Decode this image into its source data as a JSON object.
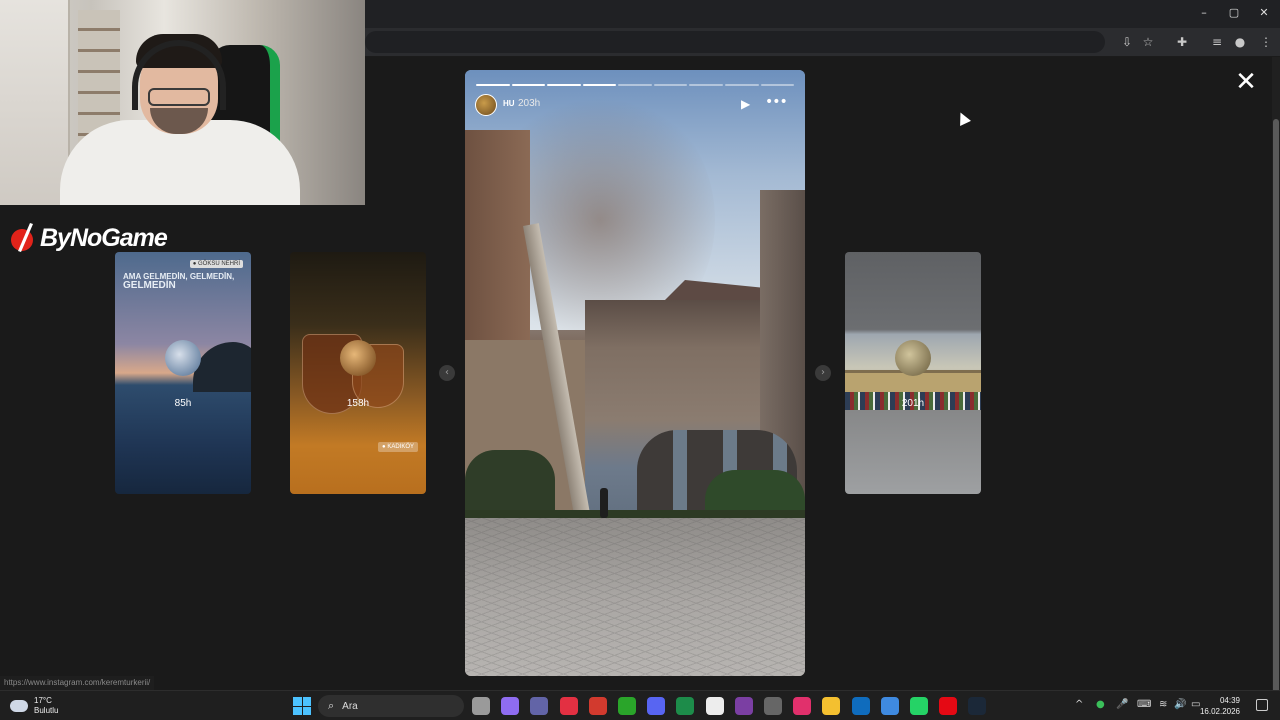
{
  "browser": {
    "window_controls": {
      "minimize": "–",
      "maximize": "▢",
      "close": "✕"
    },
    "toolbar_icons": [
      "install-icon",
      "bookmark-star-icon",
      "extensions-icon",
      "reading-list-icon",
      "profile-icon",
      "menu-icon"
    ]
  },
  "overlay": {
    "brand": "ByNoGame"
  },
  "viewer": {
    "close_label": "✕",
    "prev_arrow": "‹",
    "next_arrow": "›"
  },
  "stories_side": [
    {
      "headline_small": "AMA GELMEDİN, GELMEDİN,",
      "headline_big": "GELMEDİN",
      "tag": "● GÖKSU NEHRİ",
      "time": "85h"
    },
    {
      "tag": "● KADIKÖY",
      "time": "158h"
    },
    {
      "time": "201h"
    }
  ],
  "story_main": {
    "username": "HU",
    "time": "203h",
    "progress_segments": 9,
    "progress_done": 4,
    "play_icon": "▶",
    "more_icon": "•••"
  },
  "status_bar": {
    "url": "https://www.instagram.com/keremturkerii/"
  },
  "taskbar": {
    "weather_temp": "17°C",
    "weather_desc": "Bulutlu",
    "search_placeholder": "Ara",
    "time": "04:39",
    "date": "16.02.2026",
    "apps": [
      {
        "name": "file-view-app-icon",
        "color": "#9a9a9a"
      },
      {
        "name": "copilot-app-icon",
        "color": "#8f6cf0"
      },
      {
        "name": "teams-app-icon",
        "color": "#6264a7"
      },
      {
        "name": "opera-gx-app-icon",
        "color": "#e33042"
      },
      {
        "name": "sw-app-icon",
        "color": "#d23a2e"
      },
      {
        "name": "xbox-app-icon",
        "color": "#2aa52a"
      },
      {
        "name": "discord-app-icon",
        "color": "#5865f2"
      },
      {
        "name": "excel-app-icon",
        "color": "#1d8c4a"
      },
      {
        "name": "messenger-app-icon",
        "color": "#ededed"
      },
      {
        "name": "premiere-app-icon",
        "color": "#7b3fa3"
      },
      {
        "name": "recorder-app-icon",
        "color": "#666666"
      },
      {
        "name": "instagram-app-icon",
        "color": "#e1306c"
      },
      {
        "name": "explorer-app-icon",
        "color": "#f4c030"
      },
      {
        "name": "outlook-app-icon",
        "color": "#0f6cbd"
      },
      {
        "name": "chrome-app-icon",
        "color": "#3f8ae0"
      },
      {
        "name": "whatsapp-app-icon",
        "color": "#25d366"
      },
      {
        "name": "netflix-app-icon",
        "color": "#e50914"
      },
      {
        "name": "steam-app-icon",
        "color": "#1b2838"
      }
    ],
    "tray": [
      "^",
      "●",
      "🎤",
      "⌨",
      "≋",
      "🔊",
      "▭"
    ]
  }
}
